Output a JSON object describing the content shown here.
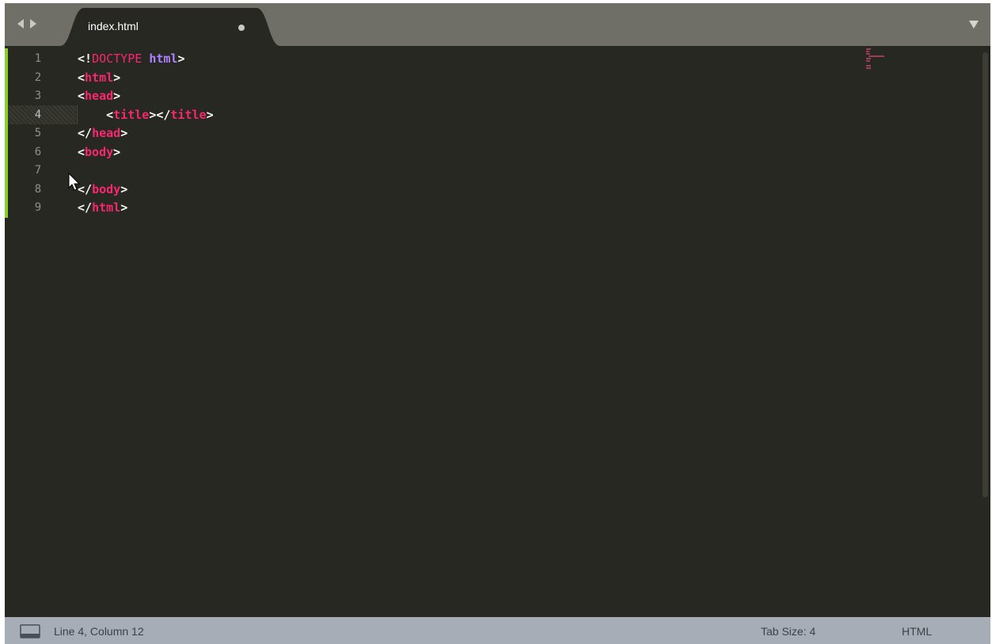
{
  "tab": {
    "title": "index.html",
    "dirty": true
  },
  "editor": {
    "lines": [
      {
        "num": "1"
      },
      {
        "num": "2"
      },
      {
        "num": "3"
      },
      {
        "num": "4"
      },
      {
        "num": "5"
      },
      {
        "num": "6"
      },
      {
        "num": "7"
      },
      {
        "num": "8"
      },
      {
        "num": "9"
      }
    ],
    "current_line": 4,
    "tokens": {
      "l1_open": "<!",
      "l1_doctype": "DOCTYPE",
      "l1_html": "html",
      "l1_close": ">",
      "l2_open": "<",
      "l2_tag": "html",
      "l2_close": ">",
      "l3_open": "<",
      "l3_tag": "head",
      "l3_close": ">",
      "l4_indent": "    ",
      "l4_open": "<",
      "l4_tag": "title",
      "l4_mid": "></",
      "l4_tag2": "title",
      "l4_close": ">",
      "l5_open": "</",
      "l5_tag": "head",
      "l5_close": ">",
      "l6_open": "<",
      "l6_tag": "body",
      "l6_close": ">",
      "l8_open": "</",
      "l8_tag": "body",
      "l8_close": ">",
      "l9_open": "</",
      "l9_tag": "html",
      "l9_close": ">"
    }
  },
  "colors": {
    "background": "#272822",
    "tag": "#f92672",
    "keyword": "#ae81ff",
    "text": "#f8f8f2",
    "gutter_modified": "#8acd2d",
    "tabbar": "#6f6f67",
    "statusbar": "#a7adb7"
  },
  "status": {
    "position": "Line 4, Column 12",
    "tab_size": "Tab Size: 4",
    "syntax": "HTML"
  },
  "icons": {
    "nav_back": "triangle-left-icon",
    "nav_forward": "triangle-right-icon",
    "tab_menu": "triangle-down-icon",
    "panel": "panel-icon",
    "dirty": "dirty-dot-icon",
    "cursor": "mouse-pointer-icon"
  }
}
